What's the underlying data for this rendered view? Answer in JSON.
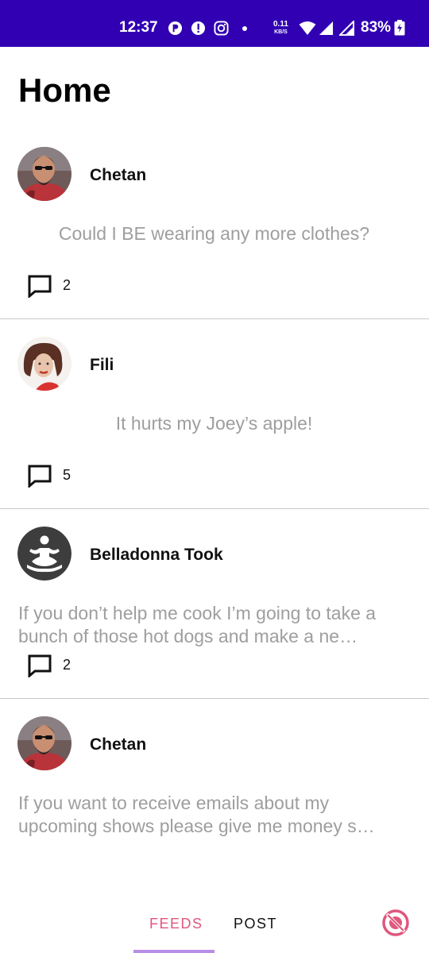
{
  "status_bar": {
    "time": "12:37",
    "net_speed_value": "0.11",
    "net_speed_unit": "KB/S",
    "battery": "83%",
    "background_color": "#3100b3"
  },
  "page": {
    "title": "Home"
  },
  "posts": [
    {
      "author": "Chetan",
      "text": "Could I BE wearing any more clothes?",
      "comments": "2",
      "avatar": "bearded-man-photo"
    },
    {
      "author": "Fili",
      "text": "It hurts my Joey’s apple!",
      "comments": "5",
      "avatar": "woman-red-hair-photo"
    },
    {
      "author": "Belladonna Took",
      "text": "If you don’t help me cook I’m going to take a bunch of those hot dogs and make a ne…",
      "comments": "2",
      "avatar": "meditation-icon"
    },
    {
      "author": "Chetan",
      "text": "If you want to receive emails about my upcoming shows please give me money s…",
      "avatar": "bearded-man-photo"
    }
  ],
  "bottom_nav": {
    "tabs": [
      {
        "label": "FEEDS",
        "selected": true
      },
      {
        "label": "POST",
        "selected": false
      }
    ],
    "accent_color": "#e0577e",
    "indicator_color": "#b78ee6"
  }
}
